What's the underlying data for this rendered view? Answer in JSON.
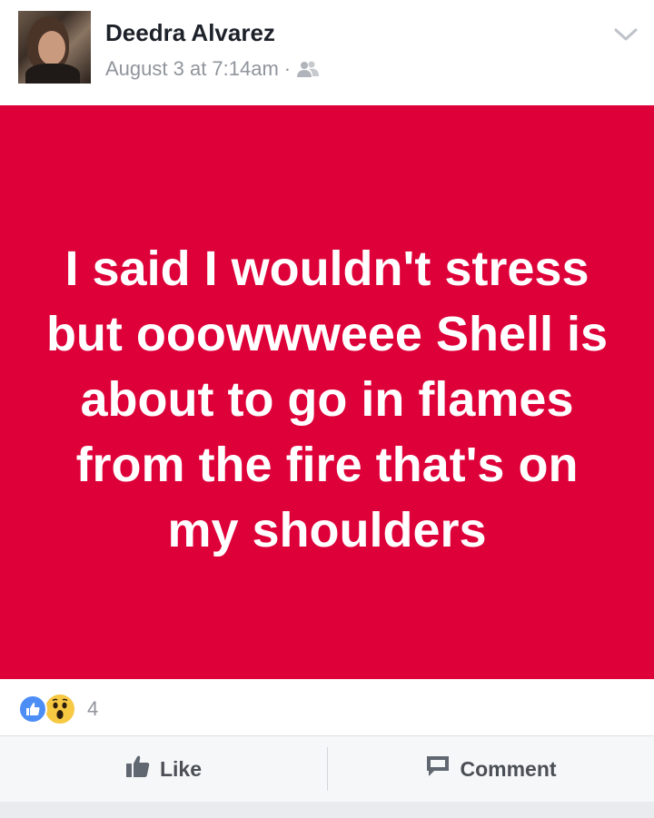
{
  "post": {
    "author": "Deedra Alvarez",
    "timestamp": "August 3 at 7:14am",
    "separator": "·",
    "audience_icon": "friends-icon",
    "menu_icon": "chevron-down-icon",
    "text": "I said I wouldn't stress but ooowwweee Shell is about to go in flames from the fire that's on my shoulders",
    "background_color": "#de0039",
    "text_color": "#ffffff"
  },
  "reactions": {
    "types": [
      "like-icon",
      "wow-icon"
    ],
    "count": "4"
  },
  "actions": {
    "like_label": "Like",
    "comment_label": "Comment"
  }
}
